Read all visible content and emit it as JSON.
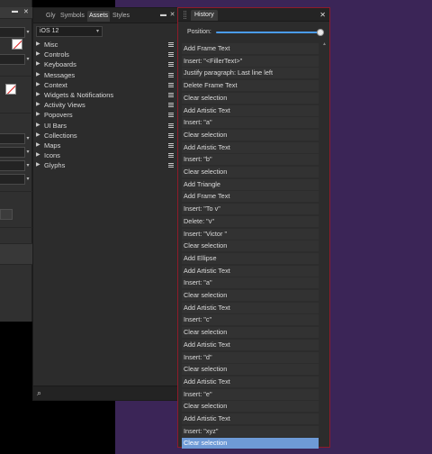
{
  "colors": {
    "accent": "#4a9cf0",
    "selection": "#6e9ad6",
    "history_border": "#8e1b2a",
    "canvas": "#3b2557"
  },
  "assets_panel": {
    "tabs": [
      "Gly",
      "Symbols",
      "Assets",
      "Styles"
    ],
    "active_tab": "Assets",
    "tab_icons": [
      "menu-icon",
      "close-icon"
    ],
    "library": "iOS 12",
    "categories": [
      "Misc",
      "Controls",
      "Keyboards",
      "Messages",
      "Context",
      "Widgets & Notifications",
      "Activity Views",
      "Popovers",
      "UI Bars",
      "Collections",
      "Maps",
      "Icons",
      "Glyphs"
    ],
    "search_icon": "search-icon"
  },
  "left_panel": {
    "icons": [
      "menu-icon",
      "close-icon",
      "no-fill-swatch-icon"
    ]
  },
  "history_panel": {
    "tab_label": "History",
    "position_label": "Position:",
    "position_value": 1.0,
    "items": [
      "Add Frame Text",
      "Insert: \"<FillerText>\"",
      "Justify paragraph: Last line left",
      "Delete Frame Text",
      "Clear selection",
      "Add Artistic Text",
      "Insert: \"a\"",
      "Clear selection",
      "Add Artistic Text",
      "Insert: \"b\"",
      "Clear selection",
      "Add Triangle",
      "Add Frame Text",
      "Insert: \"To v\"",
      "Delete: \"v\"",
      "Insert: \"Victor \"",
      "Clear selection",
      "Add Ellipse",
      "Add Artistic Text",
      "Insert: \"a\"",
      "Clear selection",
      "Add Artistic Text",
      "Insert: \"c\"",
      "Clear selection",
      "Add Artistic Text",
      "Insert: \"d\"",
      "Clear selection",
      "Add Artistic Text",
      "Insert: \"e\"",
      "Clear selection",
      "Add Artistic Text",
      "Insert: \"xyz\"",
      "Clear selection"
    ],
    "selected_index": 32
  }
}
